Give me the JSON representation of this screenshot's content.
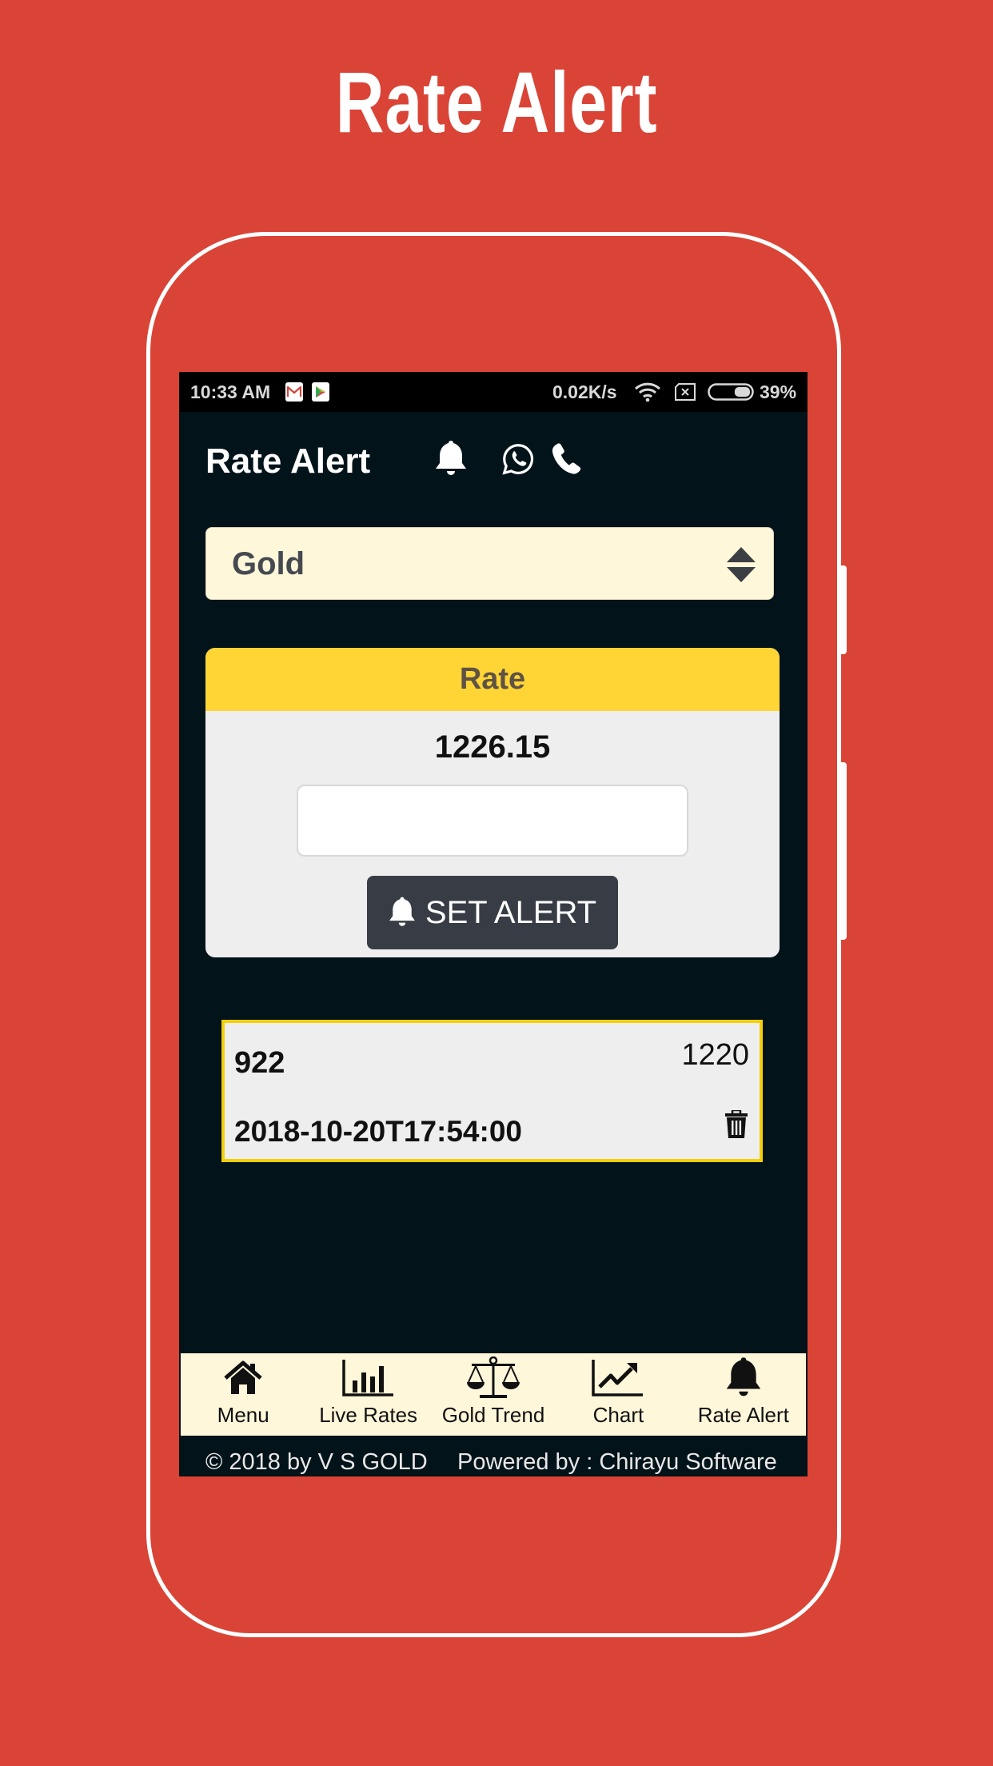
{
  "promo": {
    "title": "Rate Alert"
  },
  "status_bar": {
    "time": "10:33 AM",
    "notification_icons": [
      "gmail-icon",
      "play-store-icon"
    ],
    "network_speed": "0.02K/s",
    "wifi_icon": "wifi-icon",
    "sim_icon": "no-sim-icon",
    "battery_percent_label": "39%",
    "battery_level": 0.39
  },
  "app_bar": {
    "title": "Rate Alert",
    "actions": [
      {
        "icon": "bell-icon",
        "label": "Notifications"
      },
      {
        "icon": "whatsapp-icon",
        "label": "WhatsApp"
      },
      {
        "icon": "phone-icon",
        "label": "Call"
      }
    ]
  },
  "metal_select": {
    "selected": "Gold"
  },
  "rate_card": {
    "header": "Rate",
    "current_rate": "1226.15",
    "input_value": "",
    "input_placeholder": "",
    "button_label": "SET ALERT"
  },
  "alerts": [
    {
      "id": "922",
      "target_rate": "1220",
      "datetime": "2018-10-20T17:54:00"
    }
  ],
  "bottom_nav": {
    "items": [
      {
        "icon": "home-icon",
        "label": "Menu"
      },
      {
        "icon": "bar-chart-icon",
        "label": "Live Rates"
      },
      {
        "icon": "scale-icon",
        "label": "Gold Trend"
      },
      {
        "icon": "line-chart-icon",
        "label": "Chart"
      },
      {
        "icon": "bell-icon",
        "label": "Rate Alert"
      }
    ],
    "active_index": 4
  },
  "footer": {
    "copyright": "© 2018 by V S GOLD",
    "powered_by": "Powered by : Chirayu Software"
  },
  "colors": {
    "background": "#DA4437",
    "app_background": "#03131A",
    "card_header": "#FFD536",
    "select_background": "#FFF7DA",
    "button": "#383D45",
    "alert_border": "#F4CF0B"
  }
}
